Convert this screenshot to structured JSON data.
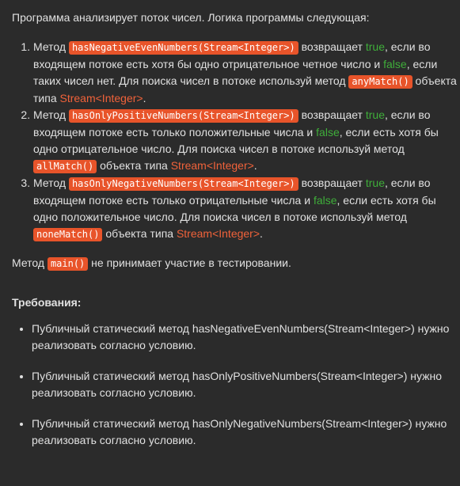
{
  "intro": "Программа анализирует поток чисел. Логика программы следующая:",
  "tasks": [
    {
      "t1": "Метод ",
      "code1": "hasNegativeEvenNumbers(Stream<Integer>)",
      "t2": " возвращает ",
      "true": "true",
      "t3": ", если во входящем потоке есть хотя бы одно отрицательное четное число и ",
      "false": "false",
      "t4": ", если таких чисел нет. Для поиска чисел в потоке используй метод ",
      "code2": "anyMatch()",
      "t5": " объекта типа ",
      "type": "Stream<Integer>",
      "t6": "."
    },
    {
      "t1": "Метод ",
      "code1": "hasOnlyPositiveNumbers(Stream<Integer>)",
      "t2": " возвращает ",
      "true": "true",
      "t3": ", если во входящем потоке есть только положительные числа и ",
      "false": "false",
      "t4": ", если есть хотя бы одно отрицательное число. Для поиска чисел в потоке используй метод ",
      "code2": "allMatch()",
      "t5": " объекта типа ",
      "type": "Stream<Integer>",
      "t6": "."
    },
    {
      "t1": "Метод ",
      "code1": "hasOnlyNegativeNumbers(Stream<Integer>)",
      "t2": " возвращает ",
      "true": "true",
      "t3": ", если во входящем потоке есть только отрицательные числа и ",
      "false": "false",
      "t4": ", если есть хотя бы одно положительное число. Для поиска чисел в потоке используй метод ",
      "code2": "noneMatch()",
      "t5": " объекта типа ",
      "type": "Stream<Integer>",
      "t6": "."
    }
  ],
  "main_note": {
    "t1": "Метод ",
    "code": "main()",
    "t2": " не принимает участие в тестировании."
  },
  "requirements": {
    "title": "Требования:",
    "items": [
      "Публичный статический метод hasNegativeEvenNumbers(Stream<Integer>) нужно реализовать согласно условию.",
      "Публичный статический метод hasOnlyPositiveNumbers(Stream<Integer>) нужно реализовать согласно условию.",
      "Публичный статический метод hasOnlyNegativeNumbers(Stream<Integer>) нужно реализовать согласно условию."
    ]
  },
  "colors": {
    "background": "#2b2b2b",
    "text": "#e0e0e0",
    "code_bg": "#e8542a",
    "true_false": "#3fae3a",
    "type_text": "#f0623a"
  }
}
